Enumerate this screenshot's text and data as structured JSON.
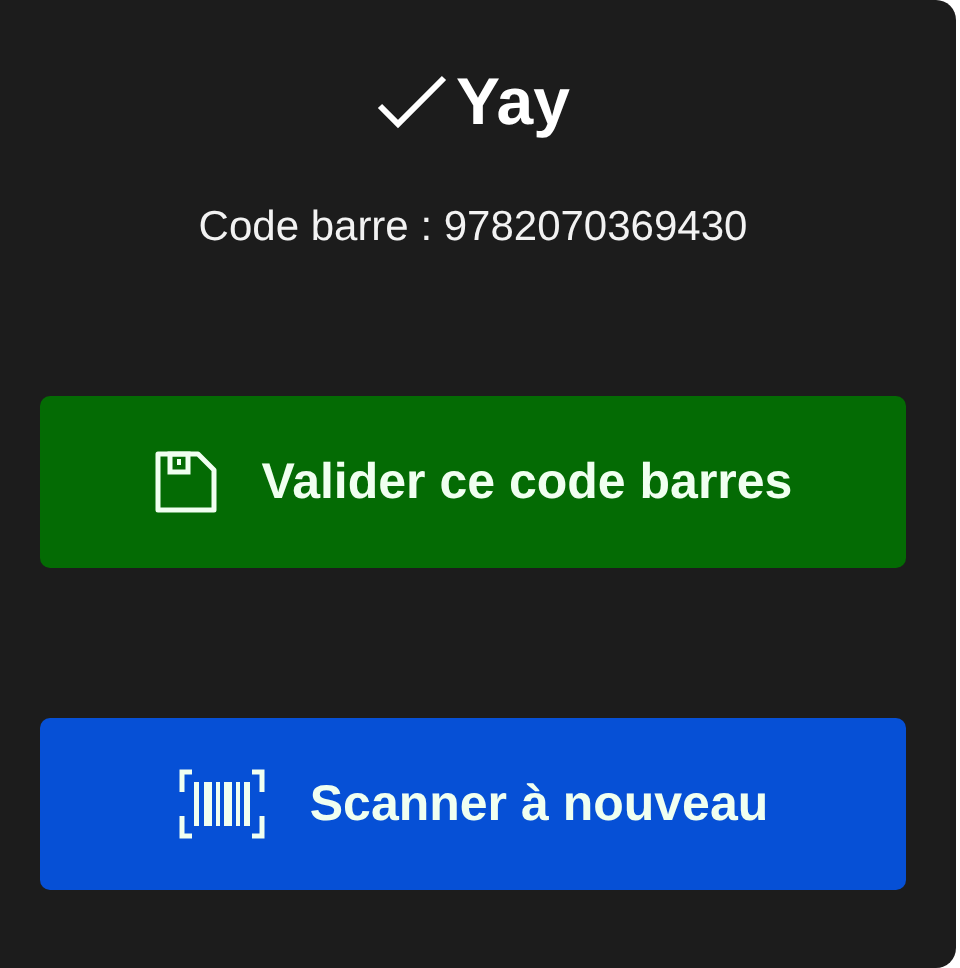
{
  "dialog": {
    "title": "Yay",
    "message": "Code barre : 9782070369430"
  },
  "buttons": [
    {
      "label": "Valider ce code barres",
      "kind": "save",
      "color": "#046b04"
    },
    {
      "label": "Scanner à nouveau",
      "kind": "scan",
      "color": "#0650d6"
    }
  ]
}
